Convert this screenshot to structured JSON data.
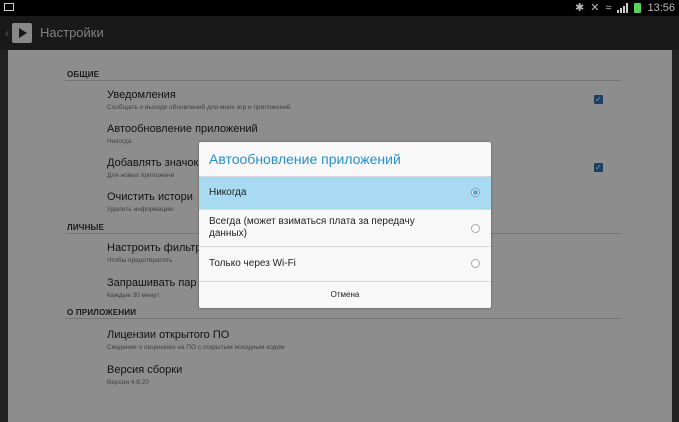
{
  "status": {
    "time": "13:56",
    "icons": [
      "bluetooth-icon",
      "mute-icon",
      "wifi-icon",
      "signal-icon",
      "battery-icon"
    ]
  },
  "appbar": {
    "title": "Настройки"
  },
  "sections": {
    "general": "ОБЩИЕ",
    "personal": "ЛИЧНЫЕ",
    "about": "О ПРИЛОЖЕНИИ"
  },
  "items": {
    "notifications": {
      "title": "Уведомления",
      "subtitle": "Сообщать о выходе обновлений для моих игр и приложений",
      "checked": true
    },
    "autoupdate": {
      "title": "Автообновление приложений",
      "subtitle": "Никогда"
    },
    "add_icons": {
      "title": "Добавлять значок",
      "subtitle": "Для новых приложени",
      "checked": true
    },
    "clear_history": {
      "title": "Очистить истори",
      "subtitle": "Удалить информацию"
    },
    "filter": {
      "title": "Настроить фильтр",
      "subtitle": "Чтобы предотвратить"
    },
    "password": {
      "title": "Запрашивать пар",
      "subtitle": "Каждые 30 минут"
    },
    "licenses": {
      "title": "Лицензии открытого ПО",
      "subtitle": "Сведения о лицензиях на ПО с открытым исходным кодом"
    },
    "build": {
      "title": "Версия сборки",
      "subtitle": "Версия 4.8.20"
    }
  },
  "dialog": {
    "title": "Автообновление приложений",
    "options": [
      {
        "label": "Никогда",
        "selected": true
      },
      {
        "label": "Всегда (может взиматься плата за передачу данных)",
        "selected": false
      },
      {
        "label": "Только через Wi-Fi",
        "selected": false
      }
    ],
    "cancel": "Отмена"
  },
  "colors": {
    "accent": "#2a8fcb",
    "selected_option": "#a8dbf1",
    "checkbox": "#2f6fa8"
  }
}
